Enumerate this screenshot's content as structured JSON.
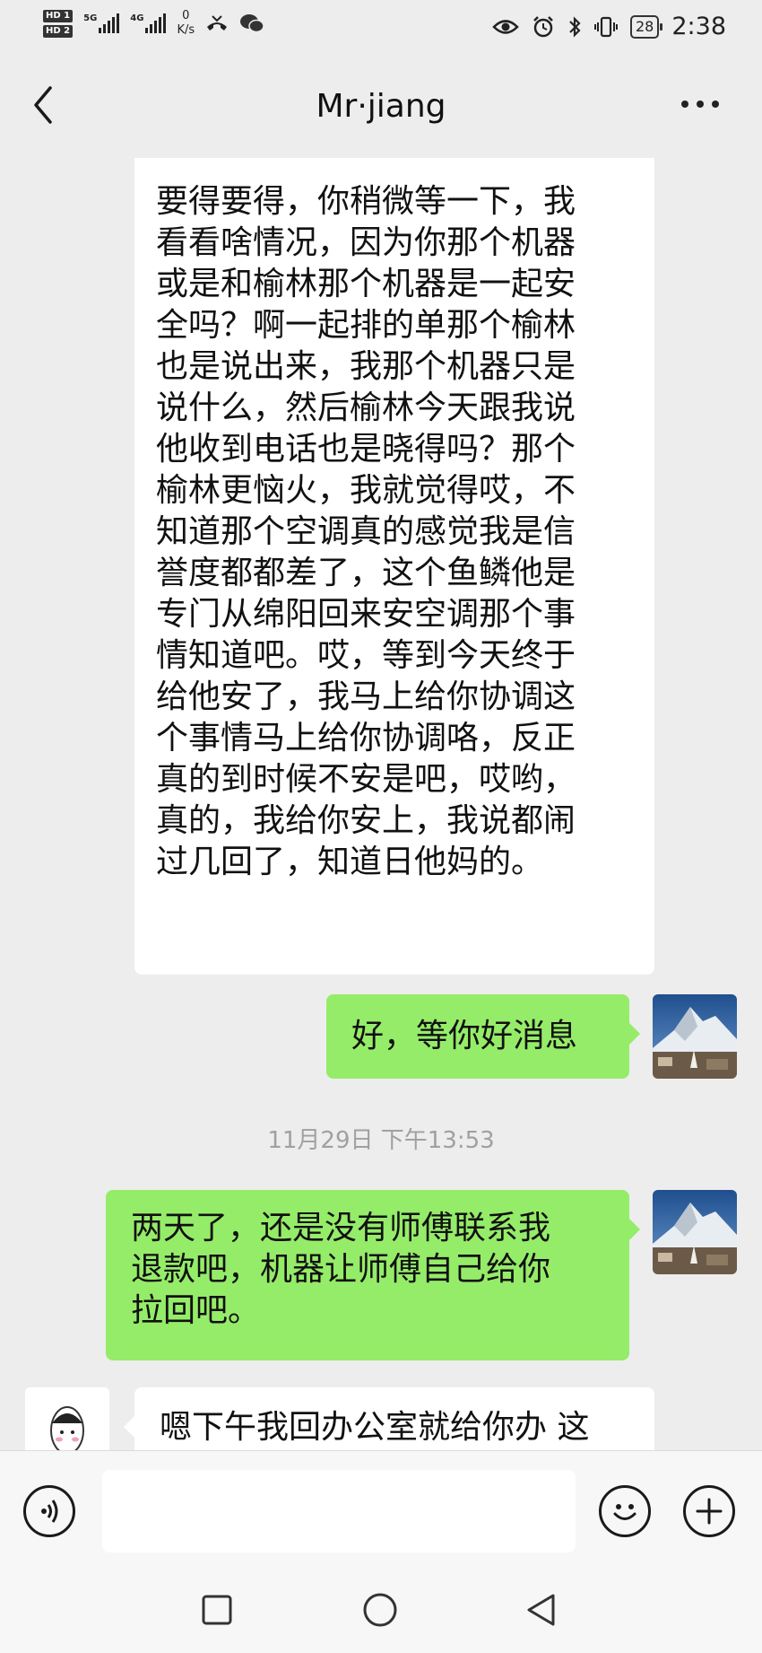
{
  "status_bar": {
    "sim1": "HD 1",
    "sim2": "HD 2",
    "net1": "5G",
    "net2": "4G",
    "speed_value": "0",
    "speed_unit": "K/s",
    "battery": "28",
    "time": "2:38",
    "icons": [
      "hd-icon",
      "signal-icon",
      "missed-call-icon",
      "wechat-icon",
      "eye-icon",
      "alarm-icon",
      "bluetooth-icon",
      "vibrate-icon",
      "battery-icon"
    ]
  },
  "header": {
    "title": "Mr·jiang",
    "back_icon": "chevron-left-icon",
    "more_icon": "more-dots-icon"
  },
  "messages": [
    {
      "side": "left",
      "lines": [
        "要得要得，你稍微等一下，我",
        "看看啥情况，因为你那个机器",
        "或是和榆林那个机器是一起安",
        "全吗？啊一起排的单那个榆林",
        "也是说出来，我那个机器只是",
        "说什么，然后榆林今天跟我说",
        "他收到电话也是晓得吗？那个",
        "榆林更恼火，我就觉得哎，不",
        "知道那个空调真的感觉我是信",
        "誉度都都差了，这个鱼鳞他是",
        "专门从绵阳回来安空调那个事",
        "情知道吧。哎，等到今天终于",
        "给他安了，我马上给你协调这",
        "个事情马上给你协调咯，反正",
        "真的到时候不安是吧，哎哟，",
        "真的，我给你安上，我说都闹",
        "过几回了，知道日他妈的。"
      ]
    },
    {
      "side": "right",
      "lines": [
        "好，等你好消息"
      ]
    },
    {
      "type": "time",
      "text": "11月29日 下午13:53"
    },
    {
      "side": "right",
      "lines": [
        "两天了，还是没有师傅联系我",
        "退款吧，机器让师傅自己给你",
        "拉回吧。"
      ]
    },
    {
      "side": "left",
      "lines": [
        "嗯下午我回办公室就给你办 这"
      ]
    }
  ],
  "input_bar": {
    "voice_icon": "voice-icon",
    "input_value": "",
    "emoji_icon": "emoji-icon",
    "add_icon": "plus-icon"
  },
  "nav_bar": {
    "icons": [
      "recents-square-icon",
      "home-circle-icon",
      "back-triangle-icon"
    ]
  },
  "colors": {
    "chat_bg": "#ededed",
    "my_bubble": "#95ec69",
    "their_bubble": "#ffffff",
    "timestamp": "#a0a0a0"
  }
}
